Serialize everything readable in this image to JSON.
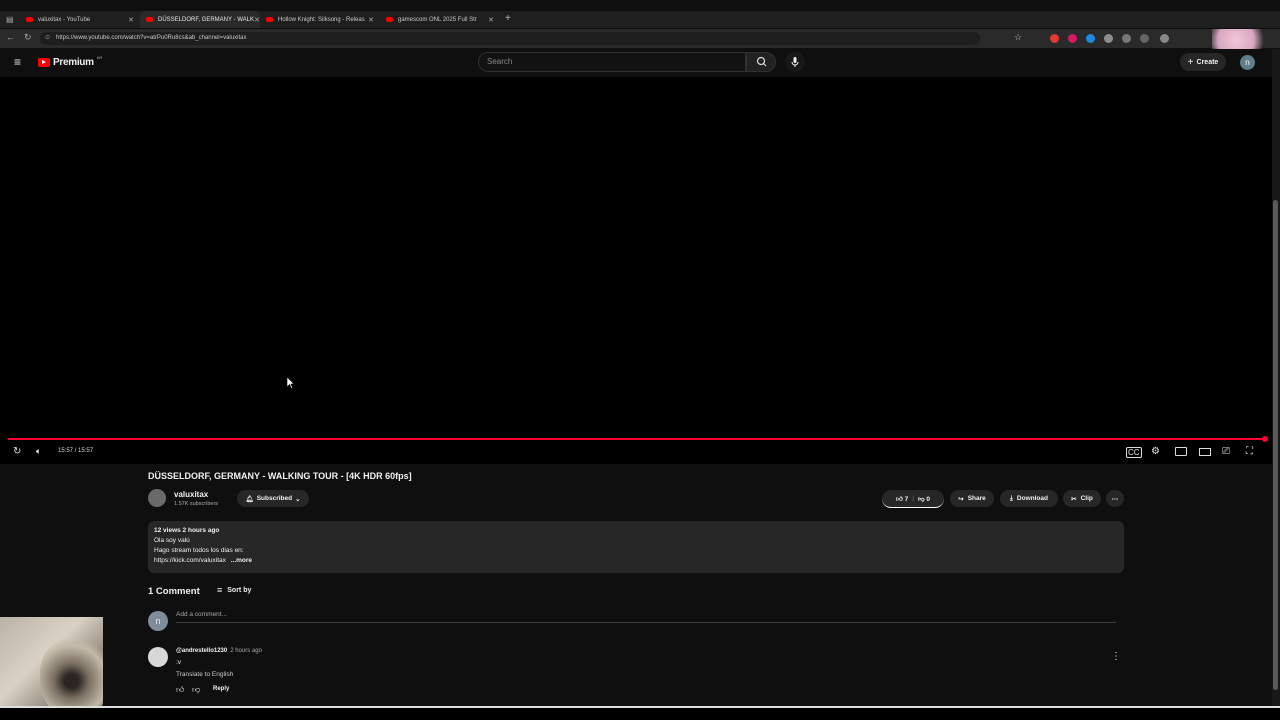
{
  "browser": {
    "tabs": [
      {
        "label": "valuxitax - YouTube",
        "active": false
      },
      {
        "label": "DÜSSELDORF, GERMANY - WALK",
        "active": true
      },
      {
        "label": "Hollow Knight: Silksong - Releas",
        "active": false
      },
      {
        "label": "gamescom ONL 2025 Full Str",
        "active": false
      }
    ],
    "new_tab": "+",
    "url": "https://www.youtube.com/watch?v=atrPu0Ru8cs&ab_channel=valuxitax"
  },
  "header": {
    "logo": "Premium",
    "logo_badge": "AR",
    "search_placeholder": "Search",
    "create_label": "Create",
    "avatar_initial": "n"
  },
  "player": {
    "time": "15:57 / 15:57",
    "progress": 1.0
  },
  "video": {
    "title": "DÜSSELDORF, GERMANY - WALKING TOUR - [4K HDR 60fps]",
    "channel": "valuxitax",
    "subscribers": "1.57K subscribers",
    "subscribed_label": "Subscribed",
    "likes": "7",
    "dislikes": "0",
    "share_label": "Share",
    "download_label": "Download",
    "clip_label": "Clip"
  },
  "description": {
    "meta": "12 views  2 hours ago",
    "line1": "Ola soy valú",
    "line2": "Hago stream todos los dias en:",
    "link": "https://kick.com/valuxitax",
    "more": "...more"
  },
  "comments": {
    "count_label": "1 Comment",
    "sort_label": "Sort by",
    "my_initial": "n",
    "add_placeholder": "Add a comment...",
    "items": [
      {
        "author": "@andrestello1230",
        "time": "2 hours ago",
        "text": ":v",
        "translate": "Translate to English",
        "reply": "Reply"
      }
    ]
  },
  "colors": {
    "accent": "#ff0033",
    "background": "#0f0f0f"
  }
}
